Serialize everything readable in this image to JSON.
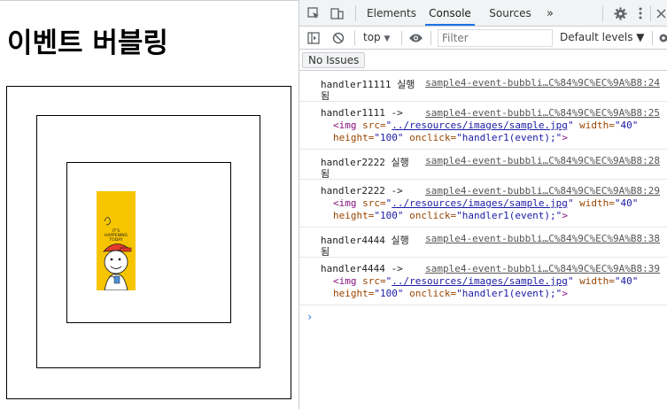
{
  "page": {
    "title": "이벤트 버블링",
    "image": {
      "caption_line1": "IT'S",
      "caption_line2": "HAPPENING",
      "caption_line3": "TODAY"
    }
  },
  "devtools": {
    "tabs": [
      {
        "label": "Elements",
        "active": false
      },
      {
        "label": "Console",
        "active": true
      },
      {
        "label": "Sources",
        "active": false
      }
    ],
    "more_tabs": "»",
    "toolbar": {
      "context": "top",
      "filter_placeholder": "Filter",
      "levels": "Default levels ▼"
    },
    "issues_button": "No Issues",
    "messages": [
      {
        "text": "handler11111 실행",
        "wrap": "됨",
        "source": "sample4-event-bubbli…C%84%9C%EC%9A%B8:24"
      },
      {
        "text": "handler1111 ->",
        "source": "sample4-event-bubbli…C%84%9C%EC%9A%B8:25",
        "element": {
          "tag_open": "<img",
          "src_attr": " src=",
          "src_q1": "\"",
          "src_val": "../resources/images/sample.jpg",
          "src_q2": "\"",
          "width_attr": " width=",
          "width_val": "\"40\"",
          "height_attr": "height=",
          "height_val": "\"100\"",
          "onclick_attr": " onclick=",
          "onclick_val": "\"handler1(event);\"",
          "tag_close": ">"
        }
      },
      {
        "text": "handler2222 실행",
        "wrap": "됨",
        "source": "sample4-event-bubbli…C%84%9C%EC%9A%B8:28"
      },
      {
        "text": "handler2222 ->",
        "source": "sample4-event-bubbli…C%84%9C%EC%9A%B8:29",
        "element": {
          "tag_open": "<img",
          "src_attr": " src=",
          "src_q1": "\"",
          "src_val": "../resources/images/sample.jpg",
          "src_q2": "\"",
          "width_attr": " width=",
          "width_val": "\"40\"",
          "height_attr": "height=",
          "height_val": "\"100\"",
          "onclick_attr": " onclick=",
          "onclick_val": "\"handler1(event);\"",
          "tag_close": ">"
        }
      },
      {
        "text": "handler4444 실행",
        "wrap": "됨",
        "source": "sample4-event-bubbli…C%84%9C%EC%9A%B8:38"
      },
      {
        "text": "handler4444 ->",
        "source": "sample4-event-bubbli…C%84%9C%EC%9A%B8:39",
        "element": {
          "tag_open": "<img",
          "src_attr": " src=",
          "src_q1": "\"",
          "src_val": "../resources/images/sample.jpg",
          "src_q2": "\"",
          "width_attr": " width=",
          "width_val": "\"40\"",
          "height_attr": "height=",
          "height_val": "\"100\"",
          "onclick_attr": " onclick=",
          "onclick_val": "\"handler1(event);\"",
          "tag_close": ">"
        }
      }
    ],
    "prompt": "›"
  },
  "colors": {
    "accent": "#1a73e8",
    "image_bg": "#f7c500",
    "cap_red": "#e23b2a"
  }
}
